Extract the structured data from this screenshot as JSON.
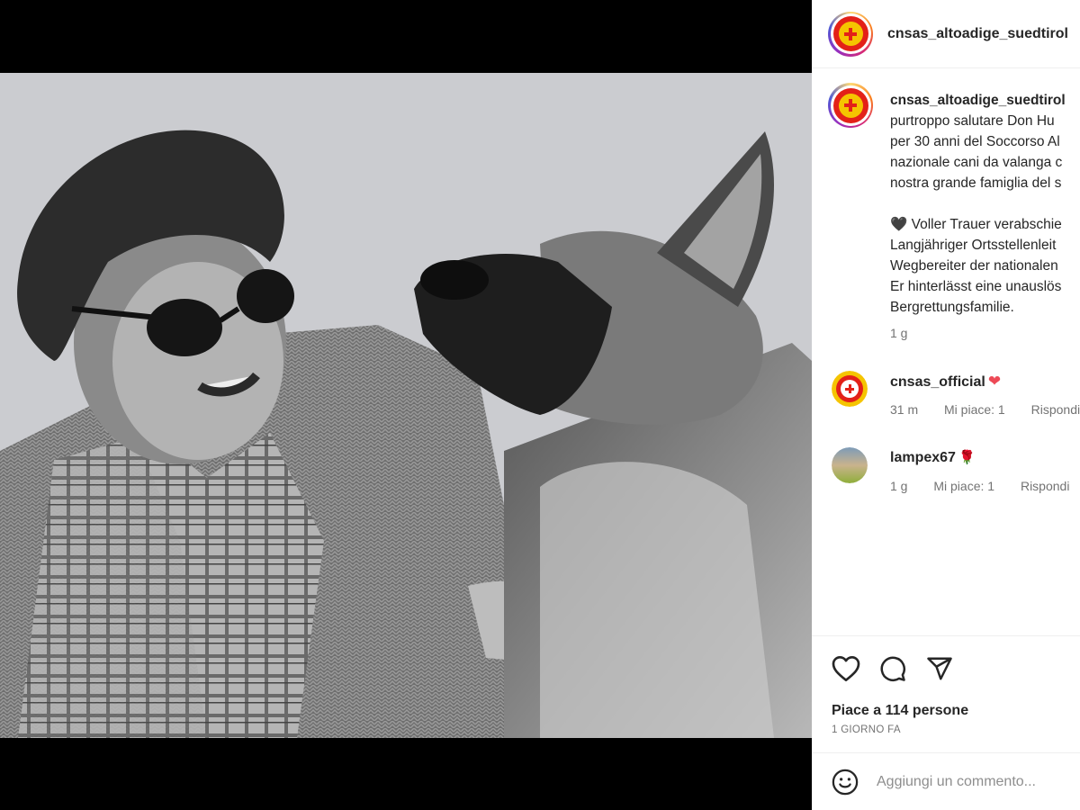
{
  "post": {
    "account": "cnsas_altoadige_suedtirol",
    "caption": {
      "username": "cnsas_altoadige_suedtirol",
      "lines_it": [
        "purtroppo salutare Don Hu",
        "per 30 anni del Soccorso Al",
        "nazionale cani da valanga c",
        "nostra grande famiglia del s"
      ],
      "heart": "🖤",
      "lines_de": [
        "Voller Trauer verabschie",
        "Langjähriger Ortsstellenleit",
        "Wegbereiter der nationalen",
        "Er hinterlässt eine unauslös",
        "Bergrettungsfamilie."
      ],
      "time": "1 g"
    },
    "comments": [
      {
        "username": "cnsas_official",
        "emoji": "❤",
        "time": "31 m",
        "likes": "Mi piace: 1",
        "reply": "Rispondi"
      },
      {
        "username": "lampex67",
        "emoji": "🌹",
        "time": "1 g",
        "likes": "Mi piace: 1",
        "reply": "Rispondi"
      }
    ],
    "likes_text": "Piace a 114 persone",
    "date_text": "1 GIORNO FA",
    "comment_placeholder": "Aggiungi un commento..."
  },
  "icons": {
    "like": "heart-outline-icon",
    "comment": "comment-bubble-icon",
    "share": "paper-plane-icon",
    "emoji": "smiley-icon"
  },
  "colors": {
    "like_heart": "#ed4956",
    "secondary_text": "#737373",
    "logo_red": "#e32118",
    "logo_yellow": "#f5c400"
  }
}
